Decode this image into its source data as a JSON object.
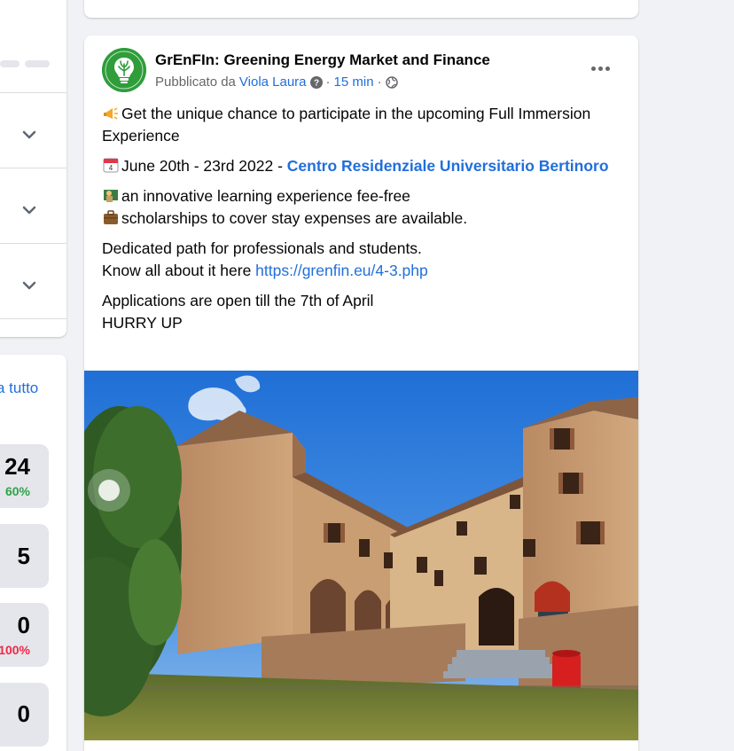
{
  "left": {
    "see_all_label": "a tutto",
    "stats": [
      {
        "value": "24",
        "percent": "60%",
        "percent_color": "#31a24c"
      },
      {
        "value": "5",
        "percent": "",
        "percent_color": ""
      },
      {
        "value": "0",
        "percent": "100%",
        "percent_color": "#f02849"
      },
      {
        "value": "0",
        "percent": "",
        "percent_color": ""
      }
    ]
  },
  "post": {
    "page_name": "GrEnFIn: Greening Energy Market and Finance",
    "meta": {
      "published_by_prefix": "Pubblicato da",
      "author": "Viola Laura",
      "separator": "·",
      "time": "15 min",
      "separator2": "·"
    },
    "lines": {
      "line1": "Get the unique chance to participate in the upcoming Full Immersion Experience",
      "date_text": "June 20th - 23rd  2022 - ",
      "venue_link": "Centro Residenziale Universitario Bertinoro",
      "bullet1": "an innovative learning experience fee-free",
      "bullet2": "scholarships to cover stay expenses are available.",
      "dedicated": "Dedicated path for professionals and students.",
      "know_prefix": "Know all about it here ",
      "know_link": "https://grenfin.eu/4-3.php",
      "applications": "Applications are open till the 7th of April",
      "hurry": "HURRY UP"
    },
    "icons": {
      "megaphone": "megaphone-emoji",
      "calendar": "calendar-emoji",
      "teacher": "teacher-emoji",
      "briefcase": "briefcase-emoji",
      "help": "question-icon",
      "globe": "globe-icon",
      "more": "more-options-icon",
      "logo": "grenfin-logo"
    }
  },
  "colors": {
    "link": "#216fdb",
    "muted": "#65676b",
    "background": "#f0f2f5",
    "logo_green": "#2e9d3a"
  }
}
